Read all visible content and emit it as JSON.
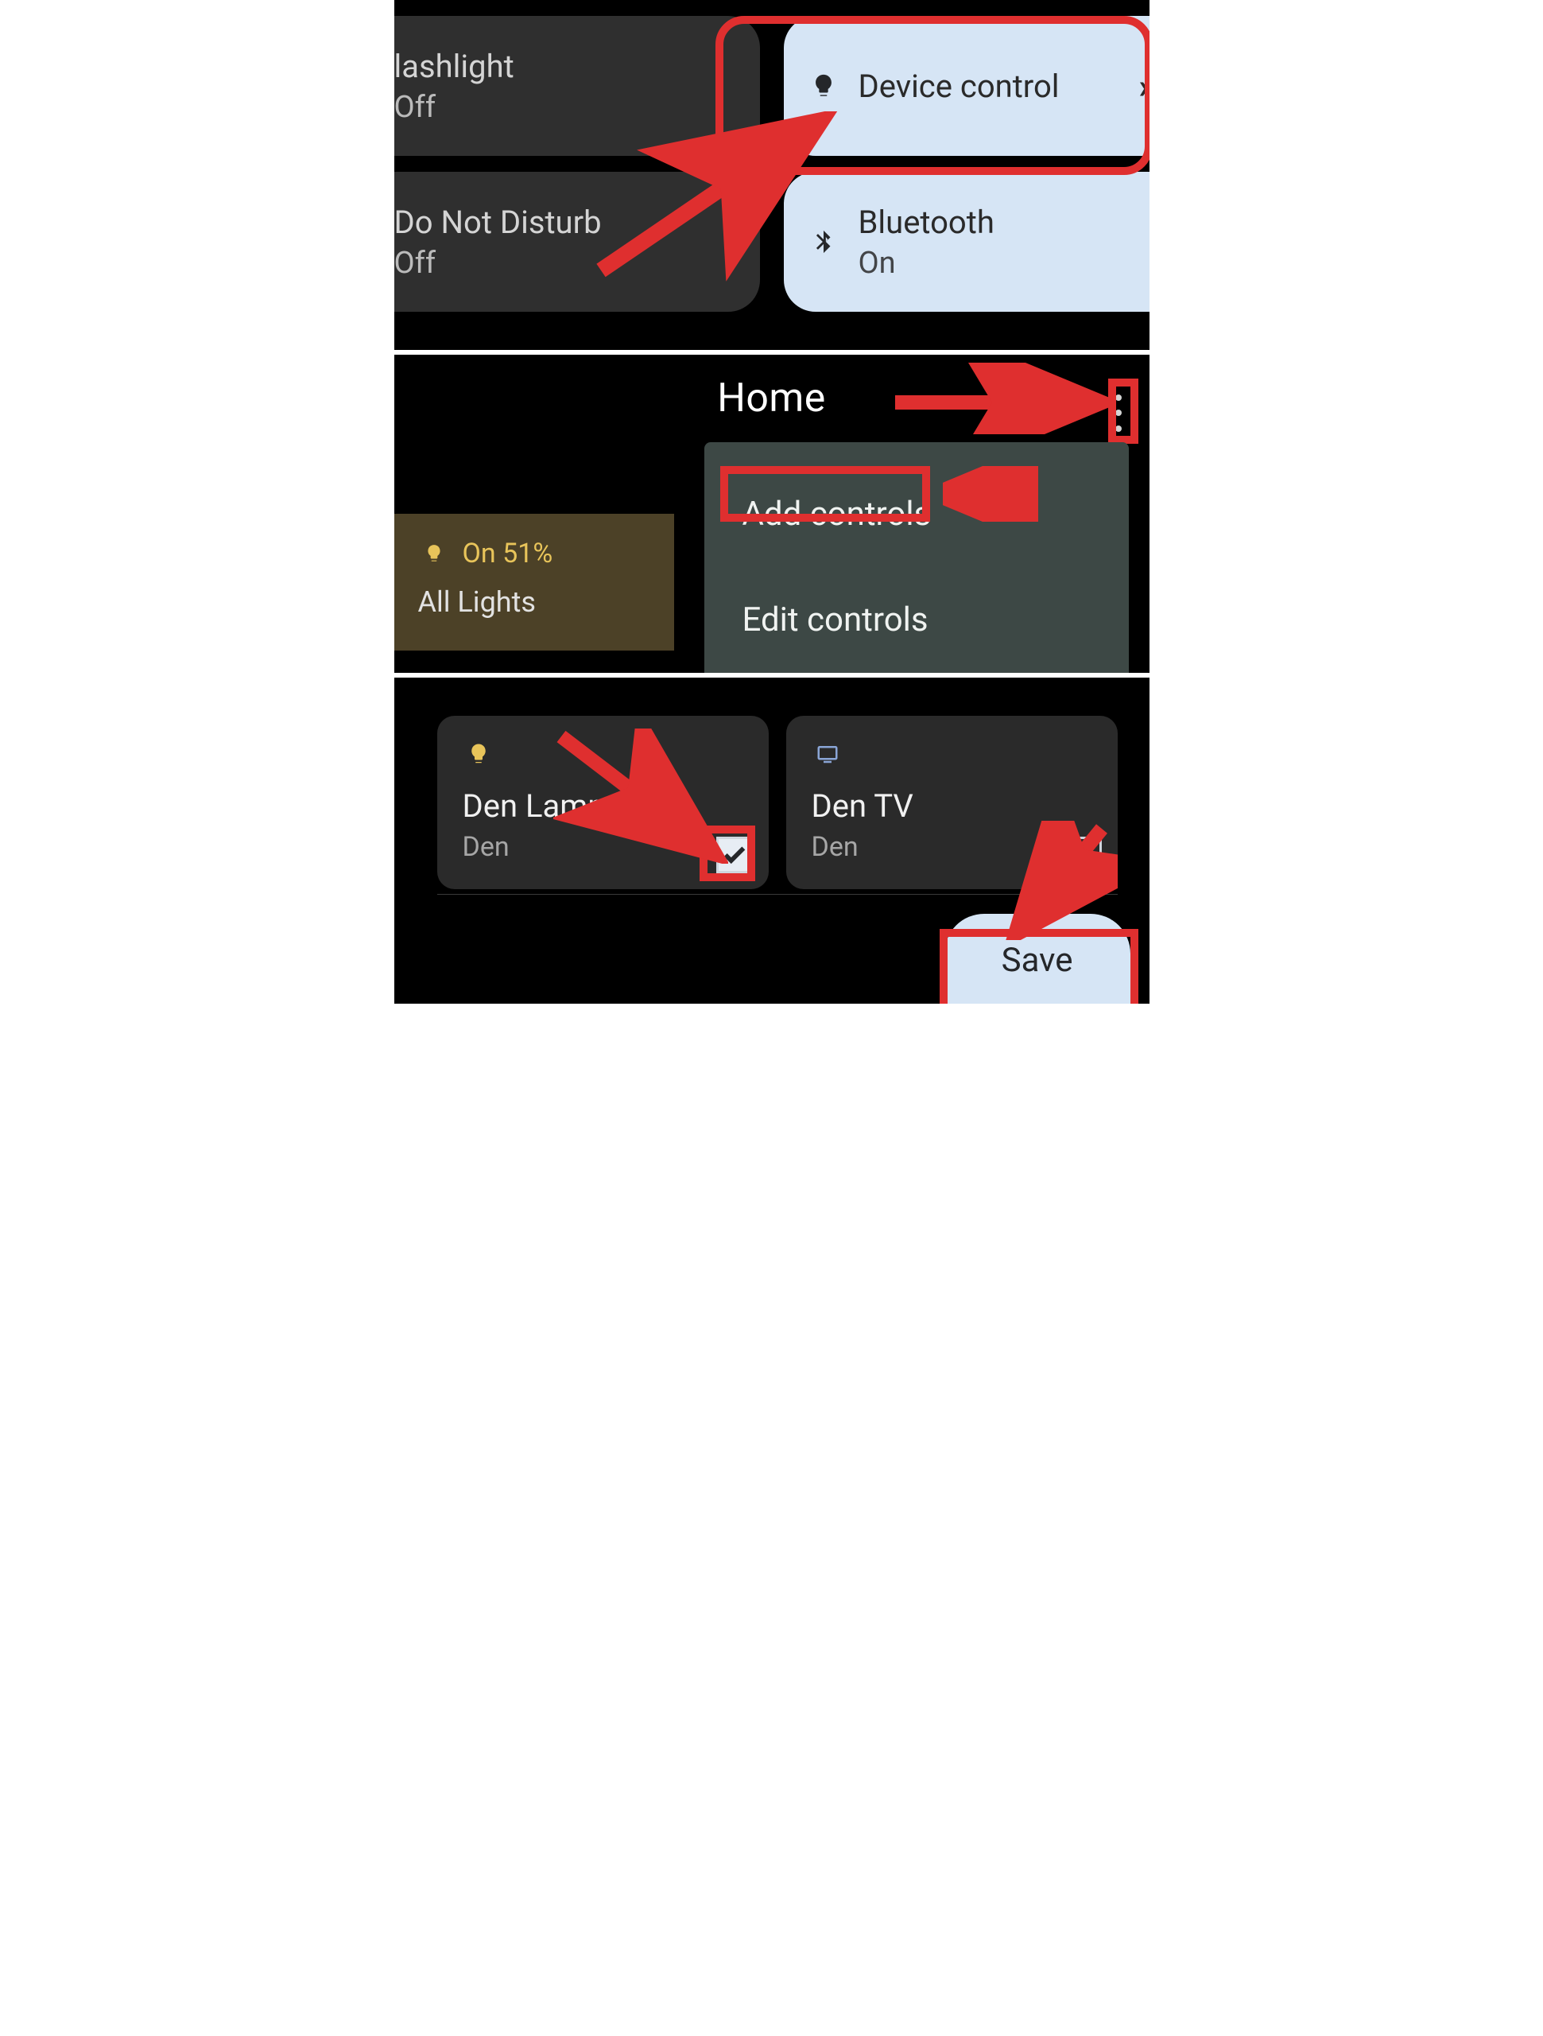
{
  "panel1": {
    "flashlight": {
      "title": "lashlight",
      "sub": "Off"
    },
    "device_controls": {
      "title": "Device control"
    },
    "dnd": {
      "title": "Do Not Disturb",
      "sub": "Off"
    },
    "bluetooth": {
      "title": "Bluetooth",
      "sub": "On"
    }
  },
  "panel2": {
    "title": "Home",
    "lights": {
      "status": "On 51%",
      "label": "All Lights"
    },
    "menu": {
      "add": "Add controls",
      "edit": "Edit controls"
    }
  },
  "panel3": {
    "devices": [
      {
        "name": "Den Lamp",
        "room": "Den",
        "checked": true,
        "icon": "lightbulb"
      },
      {
        "name": "Den TV",
        "room": "Den",
        "checked": false,
        "icon": "tv"
      }
    ],
    "save": "Save"
  }
}
